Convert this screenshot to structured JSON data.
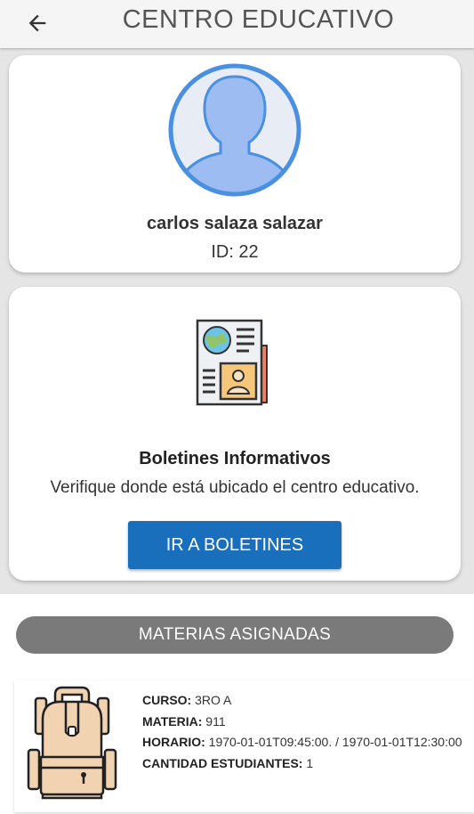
{
  "header": {
    "title": "CENTRO EDUCATIVO",
    "back_icon": "arrow-left-icon"
  },
  "profile": {
    "name": "carlos salaza salazar",
    "id_text": "ID: 22",
    "avatar_icon": "user-avatar-icon"
  },
  "bulletin": {
    "icon": "newspaper-icon",
    "title": "Boletines Informativos",
    "description": "Verifique donde está ubicado el centro educativo.",
    "button_label": "IR A BOLETINES"
  },
  "subjects": {
    "section_label": "MATERIAS ASIGNADAS",
    "items": [
      {
        "icon": "backpack-icon",
        "curso_label": "CURSO:",
        "curso": "3RO A",
        "materia_label": "MATERIA:",
        "materia": "911",
        "horario_label": "HORARIO:",
        "horario": "1970-01-01T09:45:00. / 1970-01-01T12:30:00",
        "cantidad_label": "CANTIDAD ESTUDIANTES:",
        "cantidad": "1"
      }
    ]
  },
  "colors": {
    "primary_button": "#1a6fbd",
    "pill": "#7a7a7a",
    "avatar_blue": "#4a90e2"
  }
}
